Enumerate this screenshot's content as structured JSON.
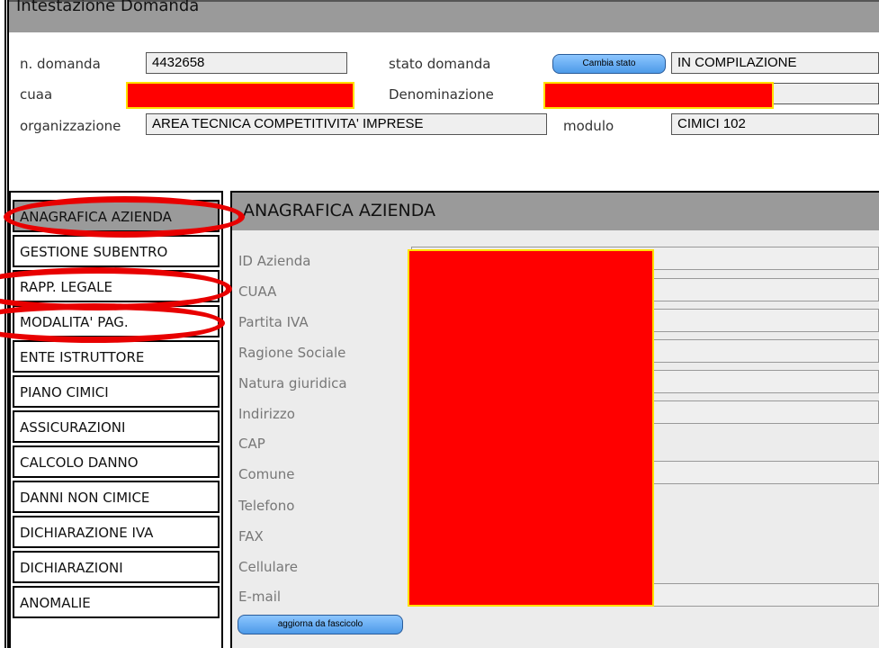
{
  "header": {
    "title": "Intestazione Domanda"
  },
  "domanda": {
    "n_domanda_label": "n. domanda",
    "n_domanda_value": "4432658",
    "stato_label": "stato domanda",
    "cambia_stato_button": "Cambia stato",
    "stato_value": "IN COMPILAZIONE",
    "cuaa_label": "cuaa",
    "denominazione_label": "Denominazione",
    "organizzazione_label": "organizzazione",
    "organizzazione_value": "AREA TECNICA COMPETITIVITA' IMPRESE",
    "modulo_label": "modulo",
    "modulo_value": "CIMICI 102"
  },
  "nav": {
    "items": [
      {
        "label": "ANAGRAFICA AZIENDA",
        "active": true
      },
      {
        "label": "GESTIONE SUBENTRO"
      },
      {
        "label": "RAPP. LEGALE"
      },
      {
        "label": "MODALITA' PAG."
      },
      {
        "label": "ENTE ISTRUTTORE"
      },
      {
        "label": "PIANO CIMICI"
      },
      {
        "label": "ASSICURAZIONI"
      },
      {
        "label": "CALCOLO DANNO"
      },
      {
        "label": "DANNI NON CIMICE"
      },
      {
        "label": "DICHIARAZIONE IVA"
      },
      {
        "label": "DICHIARAZIONI"
      },
      {
        "label": "ANOMALIE"
      }
    ]
  },
  "panel": {
    "title": "ANAGRAFICA AZIENDA",
    "fields": [
      {
        "label": "ID Azienda"
      },
      {
        "label": "CUAA"
      },
      {
        "label": "Partita IVA"
      },
      {
        "label": "Ragione Sociale"
      },
      {
        "label": "Natura giuridica"
      },
      {
        "label": "Indirizzo"
      },
      {
        "label": "CAP"
      },
      {
        "label": "Comune"
      },
      {
        "label": "Telefono"
      },
      {
        "label": "FAX"
      },
      {
        "label": "Cellulare"
      },
      {
        "label": "E-mail"
      }
    ],
    "aggiorna_button": "aggiorna da fascicolo"
  },
  "colors": {
    "redaction": "#ff0000",
    "annotation": "#e80000",
    "button_blue": "#4d9ae8"
  }
}
